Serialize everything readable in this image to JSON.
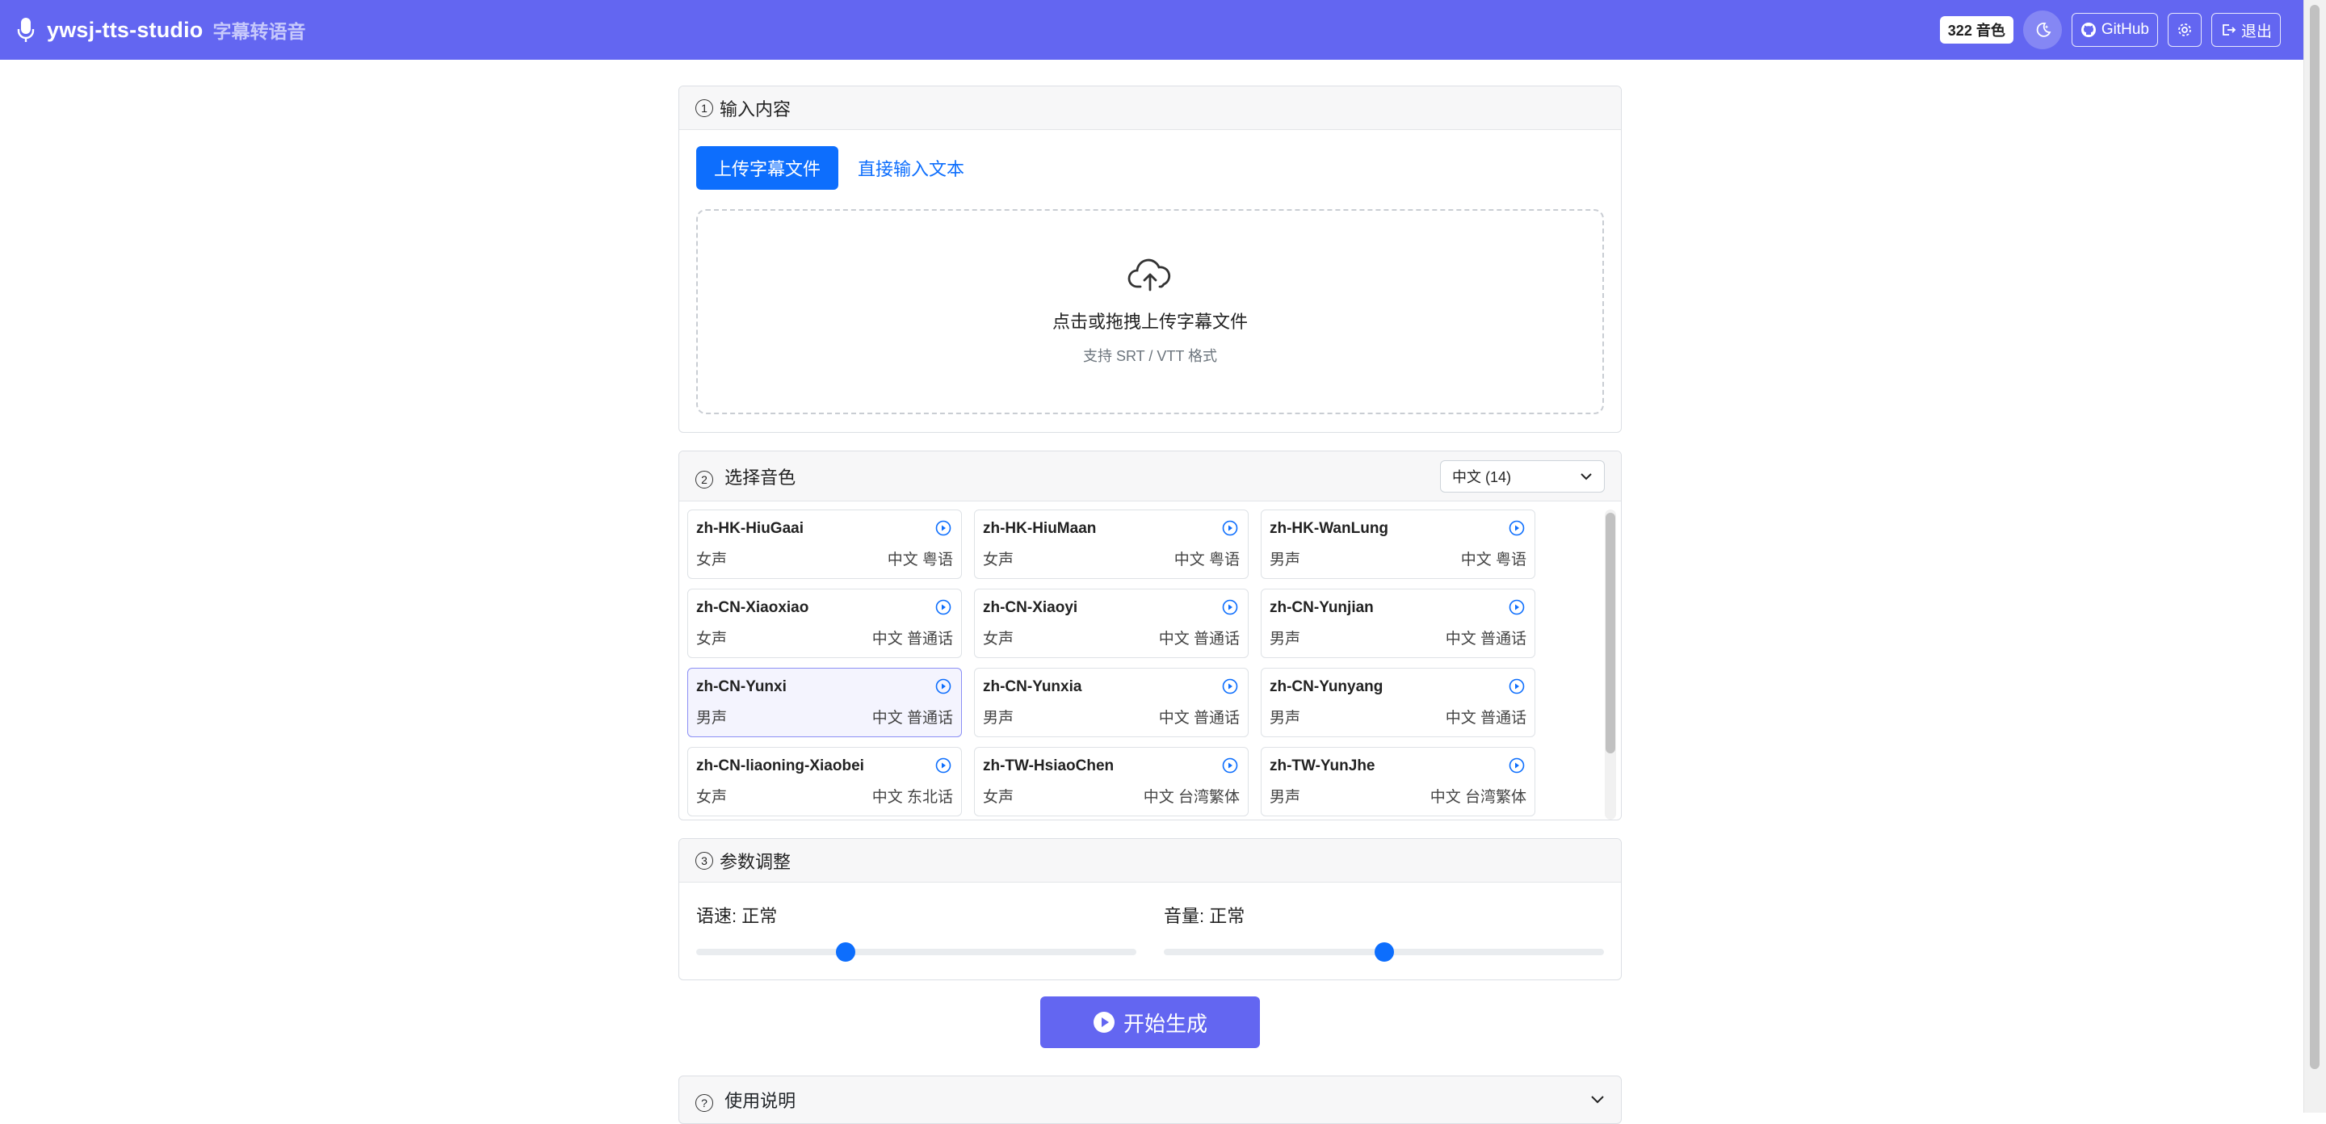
{
  "navbar": {
    "title": "ywsj-tts-studio",
    "subtitle": "字幕转语音",
    "voice_count_badge": "322 音色",
    "github_label": "GitHub",
    "logout_label": "退出",
    "bg_color": "#6366f1"
  },
  "input_section": {
    "number": "1",
    "title": "输入内容",
    "tabs": [
      {
        "label": "上传字幕文件",
        "active": true
      },
      {
        "label": "直接输入文本",
        "active": false
      }
    ],
    "dropzone": {
      "title": "点击或拖拽上传字幕文件",
      "subtitle": "支持 SRT / VTT 格式",
      "icon": "cloud-upload-icon"
    }
  },
  "voice_section": {
    "number": "2",
    "title": "选择音色",
    "language_filter": "中文 (14)",
    "voices": [
      {
        "name": "zh-HK-HiuGaai",
        "gender": "女声",
        "tags": "中文 粤语",
        "selected": false
      },
      {
        "name": "zh-HK-HiuMaan",
        "gender": "女声",
        "tags": "中文 粤语",
        "selected": false
      },
      {
        "name": "zh-HK-WanLung",
        "gender": "男声",
        "tags": "中文 粤语",
        "selected": false
      },
      {
        "name": "zh-CN-Xiaoxiao",
        "gender": "女声",
        "tags": "中文 普通话",
        "selected": false
      },
      {
        "name": "zh-CN-Xiaoyi",
        "gender": "女声",
        "tags": "中文 普通话",
        "selected": false
      },
      {
        "name": "zh-CN-Yunjian",
        "gender": "男声",
        "tags": "中文 普通话",
        "selected": false
      },
      {
        "name": "zh-CN-Yunxi",
        "gender": "男声",
        "tags": "中文 普通话",
        "selected": true
      },
      {
        "name": "zh-CN-Yunxia",
        "gender": "男声",
        "tags": "中文 普通话",
        "selected": false
      },
      {
        "name": "zh-CN-Yunyang",
        "gender": "男声",
        "tags": "中文 普通话",
        "selected": false
      },
      {
        "name": "zh-CN-liaoning-Xiaobei",
        "gender": "女声",
        "tags": "中文 东北话",
        "selected": false
      },
      {
        "name": "zh-TW-HsiaoChen",
        "gender": "女声",
        "tags": "中文 台湾繁体",
        "selected": false
      },
      {
        "name": "zh-TW-YunJhe",
        "gender": "男声",
        "tags": "中文 台湾繁体",
        "selected": false
      }
    ]
  },
  "params_section": {
    "number": "3",
    "title": "参数调整",
    "speed": {
      "label": "语速: 正常",
      "value_fraction": 0.34
    },
    "volume": {
      "label": "音量: 正常",
      "value_fraction": 0.5
    }
  },
  "generate_button": {
    "label": "开始生成"
  },
  "usage_section": {
    "number": "?",
    "title": "使用说明"
  }
}
